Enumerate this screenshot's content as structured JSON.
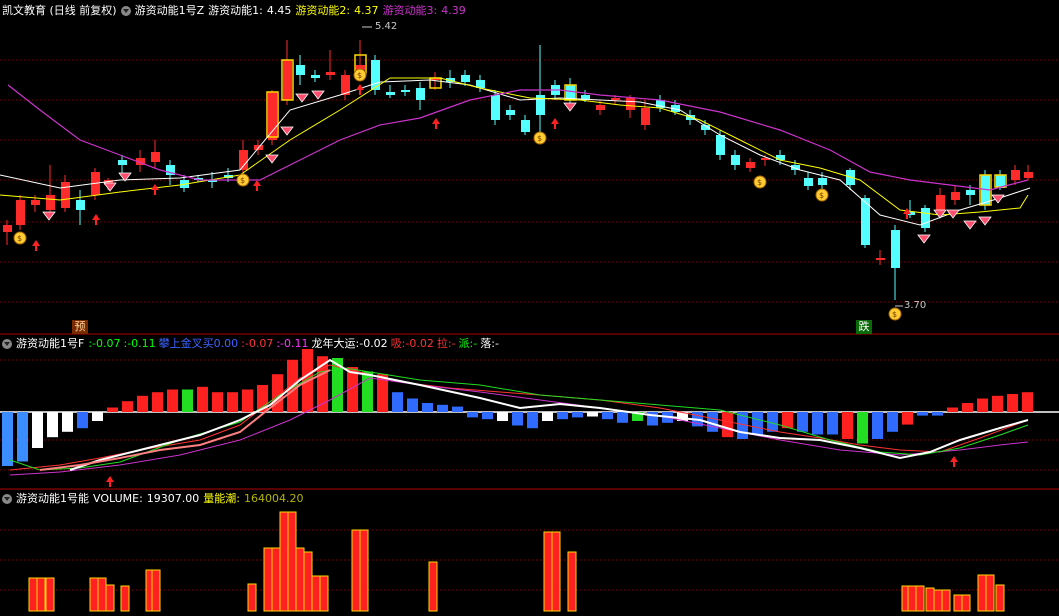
{
  "title_bar": {
    "app_title": "凯文教育 (日线 前复权)",
    "formula_name": "游资动能1号Z",
    "line1_label": "游资动能1:",
    "line1_value": "4.45",
    "line2_label": "游资动能2:",
    "line2_value": "4.37",
    "line3_label": "游资动能3:",
    "line3_value": "4.39"
  },
  "price_labels": {
    "high": "5.42",
    "low": "3.70"
  },
  "markers": {
    "yu": "预",
    "die": "跌"
  },
  "panel2": {
    "name": "游资动能1号F",
    "items": [
      {
        "label": ":",
        "value": "-0.07",
        "color": "#00ff00"
      },
      {
        "label": ":",
        "value": "-0.11",
        "color": "#00ff00"
      },
      {
        "label": "攀上金叉买",
        "value": "0.00",
        "color": "#3c64ff"
      },
      {
        "label": ":",
        "value": "-0.07",
        "color": "#ff3333"
      },
      {
        "label": ":",
        "value": "-0.11",
        "color": "#ff33ff"
      },
      {
        "label": "龙年大运:",
        "value": "-0.02",
        "color": "#ffffff"
      },
      {
        "label": "吸:",
        "value": "-0.02",
        "color": "#ff3333"
      },
      {
        "label": "拉:",
        "value": "-",
        "color": "#ff3333"
      },
      {
        "label": "派:",
        "value": "-",
        "color": "#00ff00"
      },
      {
        "label": "落:",
        "value": "-",
        "color": "#ffffff"
      }
    ]
  },
  "panel3": {
    "name": "游资动能1号能",
    "volume_label": "VOLUME:",
    "volume_value": "19307.00",
    "flow_label": "量能潮:",
    "flow_value": "164004.20"
  },
  "colors": {
    "up": "#ff2a2a",
    "down": "#54ffff",
    "ma1": "#ffffff",
    "ma2": "#ffff00",
    "ma3": "#cc33cc",
    "grid": "#8b0000"
  }
}
